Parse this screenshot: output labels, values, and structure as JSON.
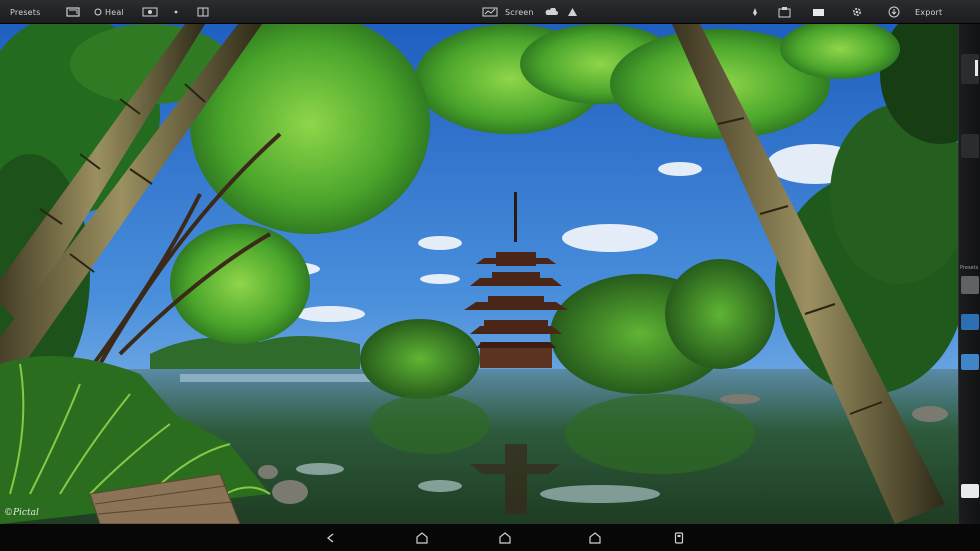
{
  "toolbar": {
    "left": [
      {
        "id": "presets",
        "label": "Presets",
        "icon": "presets-icon"
      },
      {
        "id": "crop",
        "label": "",
        "icon": "crop-icon"
      },
      {
        "id": "heal",
        "label": "Heal",
        "icon": "heal-icon"
      },
      {
        "id": "masks",
        "label": "",
        "icon": "masks-icon"
      },
      {
        "id": "dot",
        "label": "",
        "icon": "more-dot-icon"
      },
      {
        "id": "compare",
        "label": "",
        "icon": "compare-icon"
      }
    ],
    "center": [
      {
        "id": "screen",
        "label": "Screen",
        "icon": "screen-icon"
      },
      {
        "id": "cloud",
        "label": "",
        "icon": "cloud-icon"
      },
      {
        "id": "share",
        "label": "",
        "icon": "share-icon"
      }
    ],
    "right": [
      {
        "id": "brush",
        "label": "",
        "icon": "brush-icon"
      },
      {
        "id": "copy",
        "label": "",
        "icon": "copy-icon"
      },
      {
        "id": "rect",
        "label": "",
        "icon": "rectangle-icon"
      },
      {
        "id": "settings",
        "label": "",
        "icon": "gear-icon"
      },
      {
        "id": "export",
        "label": "Export",
        "icon": "export-icon"
      }
    ]
  },
  "canvas": {
    "watermark": "©Pictal",
    "description_colors": {
      "sky": "#3c7fd4",
      "foliage": "#3f8f2a",
      "water": "#3a6f5a",
      "pagoda": "#5a2e1f"
    }
  },
  "sidepanel": {
    "label": "Presets"
  },
  "navbar": [
    {
      "id": "back",
      "icon": "back-icon"
    },
    {
      "id": "home",
      "icon": "home-icon"
    },
    {
      "id": "home2",
      "icon": "home-outline-icon"
    },
    {
      "id": "home3",
      "icon": "house-icon"
    },
    {
      "id": "recents",
      "icon": "recents-icon"
    }
  ]
}
